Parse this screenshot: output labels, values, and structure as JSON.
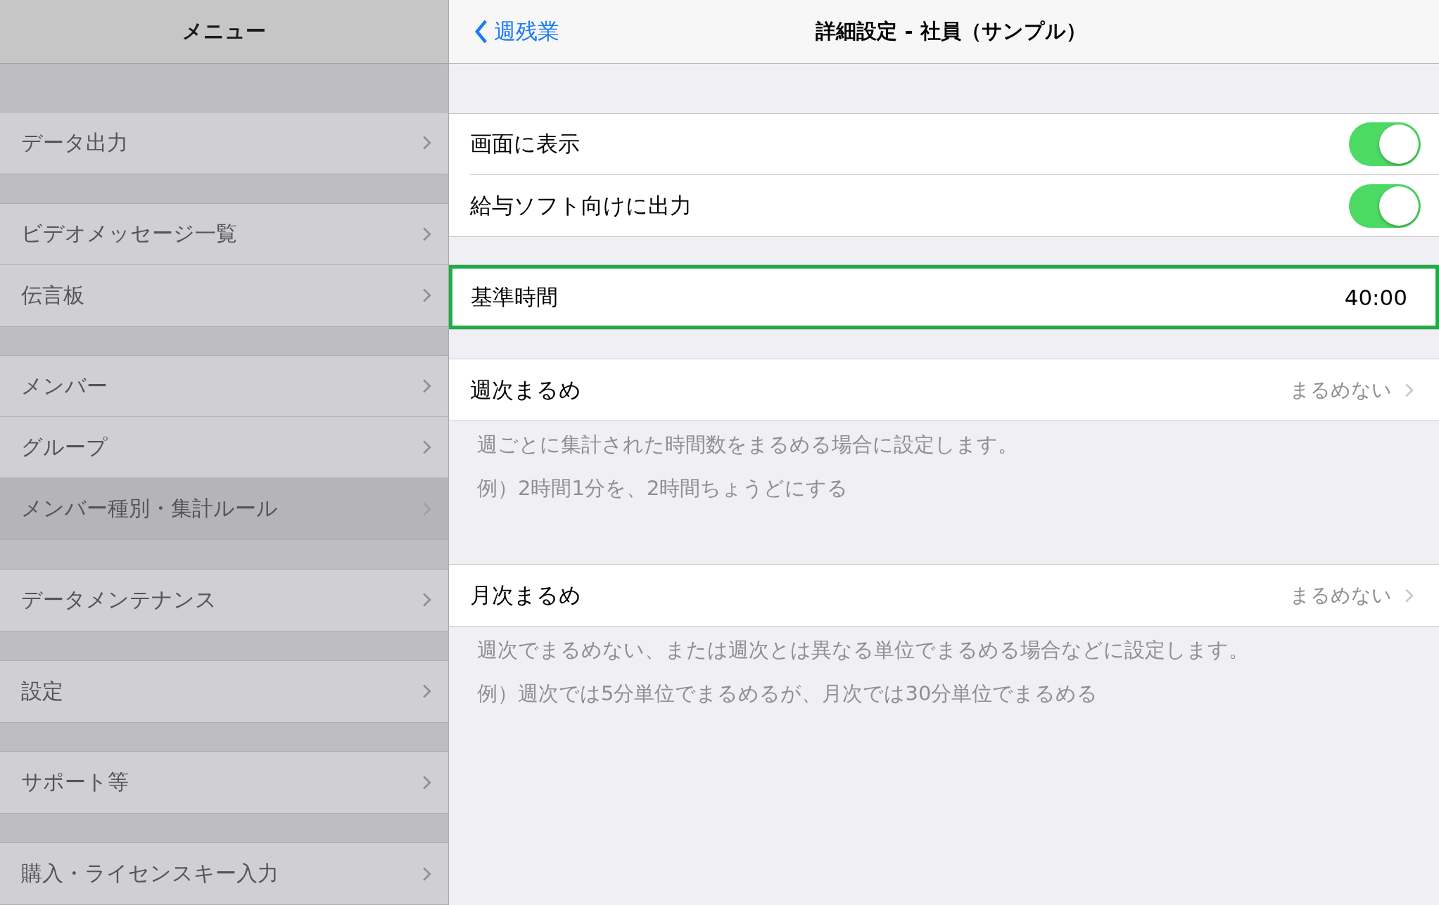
{
  "sidebar": {
    "title": "メニュー",
    "groups": [
      {
        "items": [
          {
            "label": "データ出力",
            "selected": false
          }
        ]
      },
      {
        "items": [
          {
            "label": "ビデオメッセージ一覧",
            "selected": false
          },
          {
            "label": "伝言板",
            "selected": false
          }
        ]
      },
      {
        "items": [
          {
            "label": "メンバー",
            "selected": false
          },
          {
            "label": "グループ",
            "selected": false
          },
          {
            "label": "メンバー種別・集計ルール",
            "selected": true
          }
        ]
      },
      {
        "items": [
          {
            "label": "データメンテナンス",
            "selected": false
          }
        ]
      },
      {
        "items": [
          {
            "label": "設定",
            "selected": false
          }
        ]
      },
      {
        "items": [
          {
            "label": "サポート等",
            "selected": false
          }
        ]
      },
      {
        "items": [
          {
            "label": "購入・ライセンスキー入力",
            "selected": false
          }
        ]
      }
    ]
  },
  "detail": {
    "back": "週残業",
    "title": "詳細設定 - 社員（サンプル）",
    "sections": [
      {
        "rows": [
          {
            "kind": "toggle",
            "label": "画面に表示",
            "on": true
          },
          {
            "kind": "toggle",
            "label": "給与ソフト向けに出力",
            "on": true
          }
        ]
      },
      {
        "rows": [
          {
            "kind": "value",
            "label": "基準時間",
            "value": "40:00",
            "highlighted": true
          }
        ]
      },
      {
        "rows": [
          {
            "kind": "disclosure",
            "label": "週次まるめ",
            "value": "まるめない"
          }
        ],
        "footer": [
          "週ごとに集計された時間数をまるめる場合に設定します。",
          "例）2時間1分を、2時間ちょうどにする"
        ]
      },
      {
        "rows": [
          {
            "kind": "disclosure",
            "label": "月次まるめ",
            "value": "まるめない"
          }
        ],
        "footer": [
          "週次でまるめない、または週次とは異なる単位でまるめる場合などに設定します。",
          "例）週次では5分単位でまるめるが、月次では30分単位でまるめる"
        ]
      }
    ]
  }
}
